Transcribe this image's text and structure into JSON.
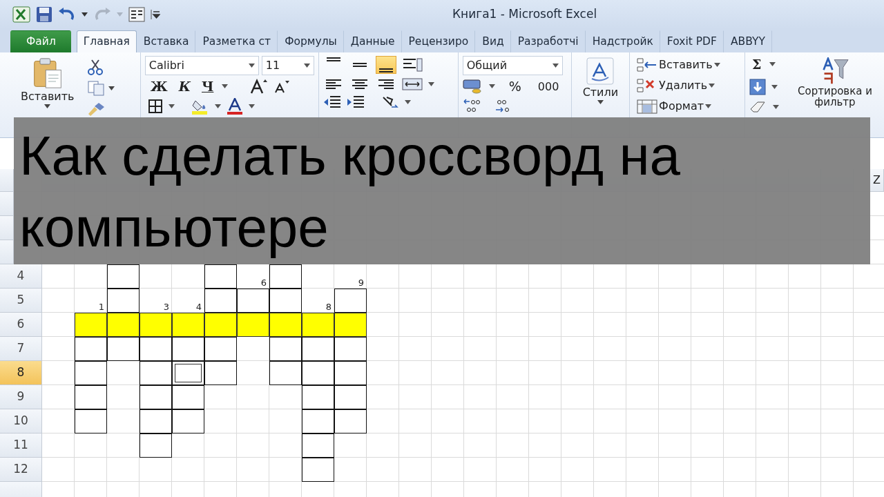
{
  "window": {
    "title": "Книга1  -  Microsoft Excel"
  },
  "tabs": [
    {
      "label": "Файл",
      "kind": "file",
      "selected": false
    },
    {
      "label": "Главная",
      "kind": "tab",
      "selected": true
    },
    {
      "label": "Вставка",
      "kind": "tab",
      "selected": false
    },
    {
      "label": "Разметка ст",
      "kind": "tab",
      "selected": false
    },
    {
      "label": "Формулы",
      "kind": "tab",
      "selected": false
    },
    {
      "label": "Данные",
      "kind": "tab",
      "selected": false
    },
    {
      "label": "Рецензиро",
      "kind": "tab",
      "selected": false
    },
    {
      "label": "Вид",
      "kind": "tab",
      "selected": false
    },
    {
      "label": "Разработчі",
      "kind": "tab",
      "selected": false
    },
    {
      "label": "Надстройк",
      "kind": "tab",
      "selected": false
    },
    {
      "label": "Foxit PDF",
      "kind": "tab",
      "selected": false
    },
    {
      "label": "ABBYY",
      "kind": "tab",
      "selected": false
    }
  ],
  "ribbon": {
    "clipboard": {
      "paste_label": "Вставить"
    },
    "font": {
      "font_name": "Calibri",
      "font_size": "11",
      "bold": "Ж",
      "italic": "К",
      "underline": "Ч"
    },
    "alignment": {
      "vertical_align": [
        {
          "selected": false
        },
        {
          "selected": false
        },
        {
          "selected": true
        }
      ]
    },
    "number": {
      "format": "Общий",
      "percent": "%",
      "thousands": "000"
    },
    "styles": {
      "label": "Стили"
    },
    "cells": {
      "insert": "Вставить",
      "delete": "Удалить",
      "format": "Формат"
    },
    "editing": {
      "autosum": "Σ",
      "sort_label": "Сортировка и фильтр"
    }
  },
  "sheet": {
    "last_column": "Z",
    "grid": [
      {
        "header": "4",
        "cells": [
          {
            "kind": "blank",
            "selected": false
          },
          {
            "kind": "blank",
            "selected": false
          },
          {
            "kind": "word",
            "selected": false
          },
          {
            "kind": "blank",
            "selected": false
          },
          {
            "kind": "blank",
            "selected": false
          },
          {
            "kind": "word",
            "selected": false
          },
          {
            "kind": "number",
            "number": "6",
            "selected": false
          },
          {
            "kind": "word",
            "selected": false
          },
          {
            "kind": "blank",
            "selected": false
          },
          {
            "kind": "number",
            "number": "9",
            "selected": false
          }
        ]
      },
      {
        "header": "5",
        "cells": [
          {
            "kind": "blank",
            "selected": false
          },
          {
            "kind": "number",
            "number": "1",
            "selected": false
          },
          {
            "kind": "word",
            "selected": false
          },
          {
            "kind": "number",
            "number": "3",
            "selected": false
          },
          {
            "kind": "number",
            "number": "4",
            "selected": false
          },
          {
            "kind": "word",
            "selected": false
          },
          {
            "kind": "word",
            "selected": false
          },
          {
            "kind": "word",
            "selected": false
          },
          {
            "kind": "number",
            "number": "8",
            "selected": false
          },
          {
            "kind": "word",
            "selected": false
          }
        ]
      },
      {
        "header": "6",
        "cells": [
          {
            "kind": "blank",
            "selected": false
          },
          {
            "kind": "keyword",
            "selected": false
          },
          {
            "kind": "keyword",
            "selected": false
          },
          {
            "kind": "keyword",
            "selected": false
          },
          {
            "kind": "keyword",
            "selected": false
          },
          {
            "kind": "keyword",
            "selected": false
          },
          {
            "kind": "keyword",
            "selected": false
          },
          {
            "kind": "keyword",
            "selected": false
          },
          {
            "kind": "keyword",
            "selected": false
          },
          {
            "kind": "keyword",
            "selected": false
          }
        ]
      },
      {
        "header": "7",
        "cells": [
          {
            "kind": "blank",
            "selected": false
          },
          {
            "kind": "word",
            "selected": false
          },
          {
            "kind": "word",
            "selected": false
          },
          {
            "kind": "word",
            "selected": false
          },
          {
            "kind": "word",
            "selected": false
          },
          {
            "kind": "word",
            "selected": false
          },
          {
            "kind": "blank",
            "selected": false
          },
          {
            "kind": "word",
            "selected": false
          },
          {
            "kind": "word",
            "selected": false
          },
          {
            "kind": "word",
            "selected": false
          }
        ]
      },
      {
        "header": "8",
        "cells": [
          {
            "kind": "blank",
            "selected": false
          },
          {
            "kind": "word",
            "selected": false
          },
          {
            "kind": "blank",
            "selected": false
          },
          {
            "kind": "word",
            "selected": false
          },
          {
            "kind": "word",
            "selected": true
          },
          {
            "kind": "word",
            "selected": false
          },
          {
            "kind": "blank",
            "selected": false
          },
          {
            "kind": "word",
            "selected": false
          },
          {
            "kind": "word",
            "selected": false
          },
          {
            "kind": "word",
            "selected": false
          }
        ]
      },
      {
        "header": "9",
        "cells": [
          {
            "kind": "blank",
            "selected": false
          },
          {
            "kind": "word",
            "selected": false
          },
          {
            "kind": "blank",
            "selected": false
          },
          {
            "kind": "word",
            "selected": false
          },
          {
            "kind": "word",
            "selected": false
          },
          {
            "kind": "blank",
            "selected": false
          },
          {
            "kind": "blank",
            "selected": false
          },
          {
            "kind": "blank",
            "selected": false
          },
          {
            "kind": "word",
            "selected": false
          },
          {
            "kind": "word",
            "selected": false
          }
        ]
      },
      {
        "header": "10",
        "cells": [
          {
            "kind": "blank",
            "selected": false
          },
          {
            "kind": "word",
            "selected": false
          },
          {
            "kind": "blank",
            "selected": false
          },
          {
            "kind": "word",
            "selected": false
          },
          {
            "kind": "word",
            "selected": false
          },
          {
            "kind": "blank",
            "selected": false
          },
          {
            "kind": "blank",
            "selected": false
          },
          {
            "kind": "blank",
            "selected": false
          },
          {
            "kind": "word",
            "selected": false
          },
          {
            "kind": "word",
            "selected": false
          }
        ]
      },
      {
        "header": "11",
        "cells": [
          {
            "kind": "blank",
            "selected": false
          },
          {
            "kind": "blank",
            "selected": false
          },
          {
            "kind": "blank",
            "selected": false
          },
          {
            "kind": "word",
            "selected": false
          },
          {
            "kind": "blank",
            "selected": false
          },
          {
            "kind": "blank",
            "selected": false
          },
          {
            "kind": "blank",
            "selected": false
          },
          {
            "kind": "blank",
            "selected": false
          },
          {
            "kind": "word",
            "selected": false
          },
          {
            "kind": "blank",
            "selected": false
          }
        ]
      },
      {
        "header": "12",
        "cells": [
          {
            "kind": "blank",
            "selected": false
          },
          {
            "kind": "blank",
            "selected": false
          },
          {
            "kind": "blank",
            "selected": false
          },
          {
            "kind": "blank",
            "selected": false
          },
          {
            "kind": "blank",
            "selected": false
          },
          {
            "kind": "blank",
            "selected": false
          },
          {
            "kind": "blank",
            "selected": false
          },
          {
            "kind": "blank",
            "selected": false
          },
          {
            "kind": "word",
            "selected": false
          },
          {
            "kind": "blank",
            "selected": false
          }
        ]
      }
    ]
  },
  "banner": {
    "title": "Как сделать кроссворд на компьютере"
  }
}
